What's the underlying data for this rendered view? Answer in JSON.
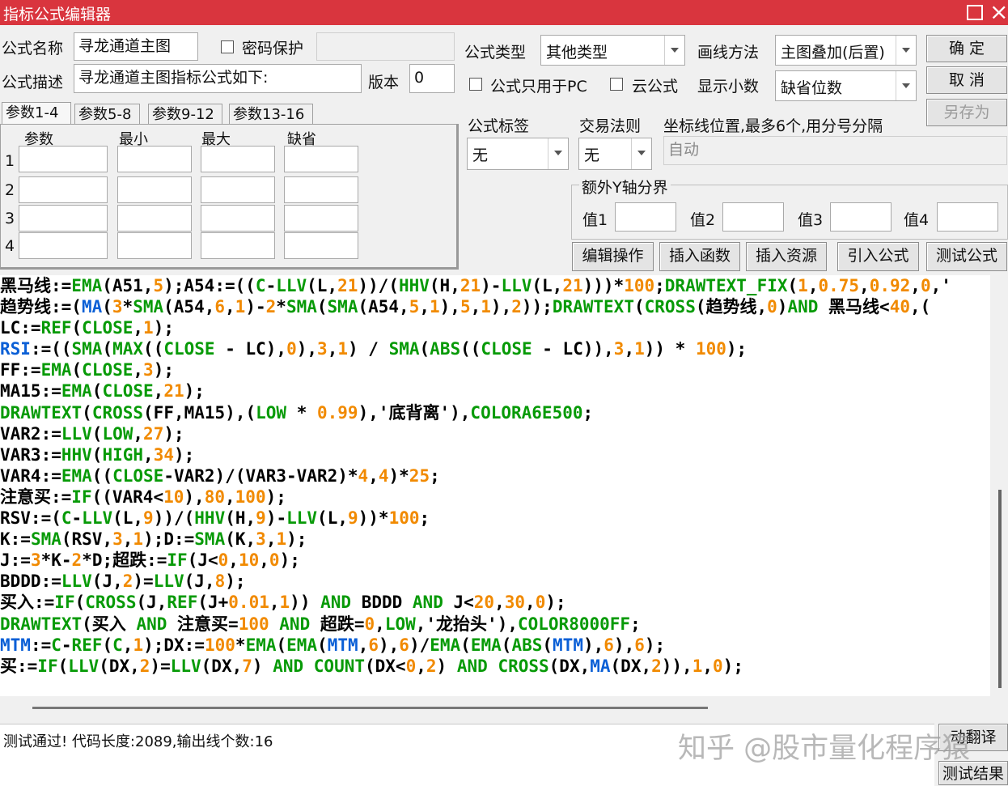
{
  "window": {
    "title": "指标公式编辑器",
    "maximize_icon": "maximize-icon",
    "close_icon": "close-icon",
    "close_glyph": "×"
  },
  "form": {
    "name_label": "公式名称",
    "name_value": "寻龙通道主图",
    "password_label": "密码保护",
    "password_value": "",
    "desc_label": "公式描述",
    "desc_value": "寻龙通道主图指标公式如下:",
    "version_label": "版本",
    "version_value": "0",
    "type_label": "公式类型",
    "type_value": "其他类型",
    "draw_label": "画线方法",
    "draw_value": "主图叠加(后置)",
    "pc_only_label": "公式只用于PC",
    "cloud_label": "云公式",
    "decimal_label": "显示小数",
    "decimal_value": "缺省位数",
    "tag_label": "公式标签",
    "tag_value": "无",
    "trade_label": "交易法则",
    "trade_value": "无",
    "coord_label": "坐标线位置,最多6个,用分号分隔",
    "coord_value": "自动",
    "extra_y_label": "额外Y轴分界",
    "value_labels": [
      "值1",
      "值2",
      "值3",
      "值4"
    ]
  },
  "buttons": {
    "ok": "确  定",
    "cancel": "取  消",
    "save_as": "另存为",
    "edit": "编辑操作",
    "insert_func": "插入函数",
    "insert_res": "插入资源",
    "import": "引入公式",
    "test": "测试公式",
    "translate": "动翻译",
    "test_result": "测试结果"
  },
  "params": {
    "tabs": [
      "参数1-4",
      "参数5-8",
      "参数9-12",
      "参数13-16"
    ],
    "headers": [
      "参数",
      "最小",
      "最大",
      "缺省"
    ],
    "rows": [
      "1",
      "2",
      "3",
      "4"
    ]
  },
  "code_lines": [
    [
      [
        "t",
        "黑马线:="
      ],
      [
        "k",
        "EMA"
      ],
      [
        "t",
        "(A51,"
      ],
      [
        "n",
        "5"
      ],
      [
        "t",
        ");A54:=(("
      ],
      [
        "k",
        "C"
      ],
      [
        "t",
        "-"
      ],
      [
        "k",
        "LLV"
      ],
      [
        "t",
        "(L,"
      ],
      [
        "n",
        "21"
      ],
      [
        "t",
        "))/("
      ],
      [
        "k",
        "HHV"
      ],
      [
        "t",
        "(H,"
      ],
      [
        "n",
        "21"
      ],
      [
        "t",
        ")-"
      ],
      [
        "k",
        "LLV"
      ],
      [
        "t",
        "(L,"
      ],
      [
        "n",
        "21"
      ],
      [
        "t",
        ")))*"
      ],
      [
        "n",
        "100"
      ],
      [
        "t",
        ";"
      ],
      [
        "k",
        "DRAWTEXT_FIX"
      ],
      [
        "t",
        "("
      ],
      [
        "n",
        "1"
      ],
      [
        "t",
        ","
      ],
      [
        "n",
        "0.75"
      ],
      [
        "t",
        ","
      ],
      [
        "n",
        "0.92"
      ],
      [
        "t",
        ","
      ],
      [
        "n",
        "0"
      ],
      [
        "t",
        ",'"
      ]
    ],
    [
      [
        "t",
        "趋势线:=("
      ],
      [
        "b",
        "MA"
      ],
      [
        "t",
        "("
      ],
      [
        "n",
        "3"
      ],
      [
        "t",
        "*"
      ],
      [
        "k",
        "SMA"
      ],
      [
        "t",
        "(A54,"
      ],
      [
        "n",
        "6"
      ],
      [
        "t",
        ","
      ],
      [
        "n",
        "1"
      ],
      [
        "t",
        ")-"
      ],
      [
        "n",
        "2"
      ],
      [
        "t",
        "*"
      ],
      [
        "k",
        "SMA"
      ],
      [
        "t",
        "("
      ],
      [
        "k",
        "SMA"
      ],
      [
        "t",
        "(A54,"
      ],
      [
        "n",
        "5"
      ],
      [
        "t",
        ","
      ],
      [
        "n",
        "1"
      ],
      [
        "t",
        "),"
      ],
      [
        "n",
        "5"
      ],
      [
        "t",
        ","
      ],
      [
        "n",
        "1"
      ],
      [
        "t",
        "),"
      ],
      [
        "n",
        "2"
      ],
      [
        "t",
        "));"
      ],
      [
        "k",
        "DRAWTEXT"
      ],
      [
        "t",
        "("
      ],
      [
        "k",
        "CROSS"
      ],
      [
        "t",
        "(趋势线,"
      ],
      [
        "n",
        "0"
      ],
      [
        "t",
        ")"
      ],
      [
        "k",
        "AND"
      ],
      [
        "t",
        " 黑马线<"
      ],
      [
        "n",
        "40"
      ],
      [
        "t",
        ",("
      ]
    ],
    [
      [
        "t",
        "LC:="
      ],
      [
        "k",
        "REF"
      ],
      [
        "t",
        "("
      ],
      [
        "k",
        "CLOSE"
      ],
      [
        "t",
        ","
      ],
      [
        "n",
        "1"
      ],
      [
        "t",
        ");"
      ]
    ],
    [
      [
        "b",
        "RSI"
      ],
      [
        "t",
        ":=(("
      ],
      [
        "k",
        "SMA"
      ],
      [
        "t",
        "("
      ],
      [
        "k",
        "MAX"
      ],
      [
        "t",
        "(("
      ],
      [
        "k",
        "CLOSE"
      ],
      [
        "t",
        " - LC),"
      ],
      [
        "n",
        "0"
      ],
      [
        "t",
        "),"
      ],
      [
        "n",
        "3"
      ],
      [
        "t",
        ","
      ],
      [
        "n",
        "1"
      ],
      [
        "t",
        ") / "
      ],
      [
        "k",
        "SMA"
      ],
      [
        "t",
        "("
      ],
      [
        "k",
        "ABS"
      ],
      [
        "t",
        "(("
      ],
      [
        "k",
        "CLOSE"
      ],
      [
        "t",
        " - LC)),"
      ],
      [
        "n",
        "3"
      ],
      [
        "t",
        ","
      ],
      [
        "n",
        "1"
      ],
      [
        "t",
        ")) * "
      ],
      [
        "n",
        "100"
      ],
      [
        "t",
        ");"
      ]
    ],
    [
      [
        "t",
        "FF:="
      ],
      [
        "k",
        "EMA"
      ],
      [
        "t",
        "("
      ],
      [
        "k",
        "CLOSE"
      ],
      [
        "t",
        ","
      ],
      [
        "n",
        "3"
      ],
      [
        "t",
        ");"
      ]
    ],
    [
      [
        "t",
        "MA15:="
      ],
      [
        "k",
        "EMA"
      ],
      [
        "t",
        "("
      ],
      [
        "k",
        "CLOSE"
      ],
      [
        "t",
        ","
      ],
      [
        "n",
        "21"
      ],
      [
        "t",
        ");"
      ]
    ],
    [
      [
        "k",
        "DRAWTEXT"
      ],
      [
        "t",
        "("
      ],
      [
        "k",
        "CROSS"
      ],
      [
        "t",
        "(FF,MA15),("
      ],
      [
        "k",
        "LOW"
      ],
      [
        "t",
        " * "
      ],
      [
        "n",
        "0.99"
      ],
      [
        "t",
        "),'底背离'),"
      ],
      [
        "k",
        "COLORA6E500"
      ],
      [
        "t",
        ";"
      ]
    ],
    [
      [
        "t",
        "VAR2:="
      ],
      [
        "k",
        "LLV"
      ],
      [
        "t",
        "("
      ],
      [
        "k",
        "LOW"
      ],
      [
        "t",
        ","
      ],
      [
        "n",
        "27"
      ],
      [
        "t",
        ");"
      ]
    ],
    [
      [
        "t",
        "VAR3:="
      ],
      [
        "k",
        "HHV"
      ],
      [
        "t",
        "("
      ],
      [
        "k",
        "HIGH"
      ],
      [
        "t",
        ","
      ],
      [
        "n",
        "34"
      ],
      [
        "t",
        ");"
      ]
    ],
    [
      [
        "t",
        "VAR4:="
      ],
      [
        "k",
        "EMA"
      ],
      [
        "t",
        "(("
      ],
      [
        "k",
        "CLOSE"
      ],
      [
        "t",
        "-VAR2)/(VAR3-VAR2)*"
      ],
      [
        "n",
        "4"
      ],
      [
        "t",
        ","
      ],
      [
        "n",
        "4"
      ],
      [
        "t",
        ")*"
      ],
      [
        "n",
        "25"
      ],
      [
        "t",
        ";"
      ]
    ],
    [
      [
        "t",
        "注意买:="
      ],
      [
        "k",
        "IF"
      ],
      [
        "t",
        "((VAR4<"
      ],
      [
        "n",
        "10"
      ],
      [
        "t",
        "),"
      ],
      [
        "n",
        "80"
      ],
      [
        "t",
        ","
      ],
      [
        "n",
        "100"
      ],
      [
        "t",
        ");"
      ]
    ],
    [
      [
        "t",
        "RSV:=("
      ],
      [
        "k",
        "C"
      ],
      [
        "t",
        "-"
      ],
      [
        "k",
        "LLV"
      ],
      [
        "t",
        "(L,"
      ],
      [
        "n",
        "9"
      ],
      [
        "t",
        "))/("
      ],
      [
        "k",
        "HHV"
      ],
      [
        "t",
        "(H,"
      ],
      [
        "n",
        "9"
      ],
      [
        "t",
        ")-"
      ],
      [
        "k",
        "LLV"
      ],
      [
        "t",
        "(L,"
      ],
      [
        "n",
        "9"
      ],
      [
        "t",
        "))*"
      ],
      [
        "n",
        "100"
      ],
      [
        "t",
        ";"
      ]
    ],
    [
      [
        "t",
        "K:="
      ],
      [
        "k",
        "SMA"
      ],
      [
        "t",
        "(RSV,"
      ],
      [
        "n",
        "3"
      ],
      [
        "t",
        ","
      ],
      [
        "n",
        "1"
      ],
      [
        "t",
        ");D:="
      ],
      [
        "k",
        "SMA"
      ],
      [
        "t",
        "(K,"
      ],
      [
        "n",
        "3"
      ],
      [
        "t",
        ","
      ],
      [
        "n",
        "1"
      ],
      [
        "t",
        ");"
      ]
    ],
    [
      [
        "t",
        "J:="
      ],
      [
        "n",
        "3"
      ],
      [
        "t",
        "*K-"
      ],
      [
        "n",
        "2"
      ],
      [
        "t",
        "*D;超跌:="
      ],
      [
        "k",
        "IF"
      ],
      [
        "t",
        "(J<"
      ],
      [
        "n",
        "0"
      ],
      [
        "t",
        ","
      ],
      [
        "n",
        "10"
      ],
      [
        "t",
        ","
      ],
      [
        "n",
        "0"
      ],
      [
        "t",
        ");"
      ]
    ],
    [
      [
        "t",
        "BDDD:="
      ],
      [
        "k",
        "LLV"
      ],
      [
        "t",
        "(J,"
      ],
      [
        "n",
        "2"
      ],
      [
        "t",
        ")="
      ],
      [
        "k",
        "LLV"
      ],
      [
        "t",
        "(J,"
      ],
      [
        "n",
        "8"
      ],
      [
        "t",
        ");"
      ]
    ],
    [
      [
        "t",
        "买入:="
      ],
      [
        "k",
        "IF"
      ],
      [
        "t",
        "("
      ],
      [
        "k",
        "CROSS"
      ],
      [
        "t",
        "(J,"
      ],
      [
        "k",
        "REF"
      ],
      [
        "t",
        "(J+"
      ],
      [
        "n",
        "0.01"
      ],
      [
        "t",
        ","
      ],
      [
        "n",
        "1"
      ],
      [
        "t",
        ")) "
      ],
      [
        "k",
        "AND"
      ],
      [
        "t",
        " BDDD "
      ],
      [
        "k",
        "AND"
      ],
      [
        "t",
        " J<"
      ],
      [
        "n",
        "20"
      ],
      [
        "t",
        ","
      ],
      [
        "n",
        "30"
      ],
      [
        "t",
        ","
      ],
      [
        "n",
        "0"
      ],
      [
        "t",
        ");"
      ]
    ],
    [
      [
        "k",
        "DRAWTEXT"
      ],
      [
        "t",
        "(买入 "
      ],
      [
        "k",
        "AND"
      ],
      [
        "t",
        " 注意买="
      ],
      [
        "n",
        "100"
      ],
      [
        "t",
        " "
      ],
      [
        "k",
        "AND"
      ],
      [
        "t",
        " 超跌="
      ],
      [
        "n",
        "0"
      ],
      [
        "t",
        ","
      ],
      [
        "k",
        "LOW"
      ],
      [
        "t",
        ",'龙抬头'),"
      ],
      [
        "k",
        "COLOR8000FF"
      ],
      [
        "t",
        ";"
      ]
    ],
    [
      [
        "b",
        "MTM"
      ],
      [
        "t",
        ":="
      ],
      [
        "k",
        "C"
      ],
      [
        "t",
        "-"
      ],
      [
        "k",
        "REF"
      ],
      [
        "t",
        "("
      ],
      [
        "k",
        "C"
      ],
      [
        "t",
        ","
      ],
      [
        "n",
        "1"
      ],
      [
        "t",
        ");DX:="
      ],
      [
        "n",
        "100"
      ],
      [
        "t",
        "*"
      ],
      [
        "k",
        "EMA"
      ],
      [
        "t",
        "("
      ],
      [
        "k",
        "EMA"
      ],
      [
        "t",
        "("
      ],
      [
        "b",
        "MTM"
      ],
      [
        "t",
        ","
      ],
      [
        "n",
        "6"
      ],
      [
        "t",
        "),"
      ],
      [
        "n",
        "6"
      ],
      [
        "t",
        ")/"
      ],
      [
        "k",
        "EMA"
      ],
      [
        "t",
        "("
      ],
      [
        "k",
        "EMA"
      ],
      [
        "t",
        "("
      ],
      [
        "k",
        "ABS"
      ],
      [
        "t",
        "("
      ],
      [
        "b",
        "MTM"
      ],
      [
        "t",
        "),"
      ],
      [
        "n",
        "6"
      ],
      [
        "t",
        "),"
      ],
      [
        "n",
        "6"
      ],
      [
        "t",
        ");"
      ]
    ],
    [
      [
        "t",
        "买:="
      ],
      [
        "k",
        "IF"
      ],
      [
        "t",
        "("
      ],
      [
        "k",
        "LLV"
      ],
      [
        "t",
        "(DX,"
      ],
      [
        "n",
        "2"
      ],
      [
        "t",
        ")="
      ],
      [
        "k",
        "LLV"
      ],
      [
        "t",
        "(DX,"
      ],
      [
        "n",
        "7"
      ],
      [
        "t",
        ") "
      ],
      [
        "k",
        "AND"
      ],
      [
        "t",
        " "
      ],
      [
        "k",
        "COUNT"
      ],
      [
        "t",
        "(DX<"
      ],
      [
        "n",
        "0"
      ],
      [
        "t",
        ","
      ],
      [
        "n",
        "2"
      ],
      [
        "t",
        ") "
      ],
      [
        "k",
        "AND"
      ],
      [
        "t",
        " "
      ],
      [
        "k",
        "CROSS"
      ],
      [
        "t",
        "(DX,"
      ],
      [
        "b",
        "MA"
      ],
      [
        "t",
        "(DX,"
      ],
      [
        "n",
        "2"
      ],
      [
        "t",
        ")),"
      ],
      [
        "n",
        "1"
      ],
      [
        "t",
        ","
      ],
      [
        "n",
        "0"
      ],
      [
        "t",
        ");"
      ]
    ]
  ],
  "status": {
    "message": "测试通过! 代码长度:2089,输出线个数:16"
  },
  "watermark": "知乎 @股市量化程序猿"
}
